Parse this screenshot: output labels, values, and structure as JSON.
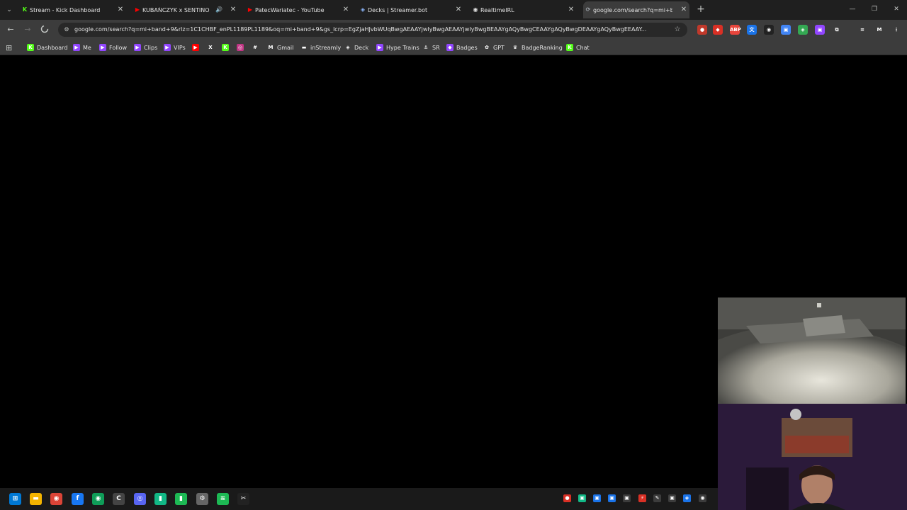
{
  "browser": {
    "tabs": [
      {
        "title": "Stream - Kick Dashboard",
        "favicon": "kick-icon",
        "color": "#53fc18"
      },
      {
        "title": "KUBAŃCZYK x SENTINO - R",
        "favicon": "youtube-icon",
        "color": "#ff0000",
        "audio": "speaker-icon"
      },
      {
        "title": "PatecWariatec - YouTube",
        "favicon": "youtube-icon",
        "color": "#ff0000"
      },
      {
        "title": "Decks | Streamer.bot",
        "favicon": "streamerbot-icon",
        "color": "#8ab4f8"
      },
      {
        "title": "RealtimeIRL",
        "favicon": "github-icon",
        "color": "#e3e3e3"
      },
      {
        "title": "google.com/search?q=mi+ban",
        "favicon": "loading-icon",
        "color": "#9aa0a6",
        "active": true
      }
    ],
    "tab_close_glyph": "✕",
    "new_tab_glyph": "+",
    "window_controls": {
      "minimize": "—",
      "restore": "❐",
      "close": "✕"
    },
    "tab_search_glyph": "⌄"
  },
  "toolbar": {
    "back": "←",
    "forward": "→",
    "reload": "✕",
    "info_glyph": "⚙",
    "url": "google.com/search?q=mi+band+9&rlz=1C1CHBF_enPL1189PL1189&oq=mi+band+9&gs_lcrp=EgZjaHJvbWUqBwgAEAAYjwIyBwgAEAAYjwIyBwgBEAAYgAQyBwgCEAAYgAQyBwgDEAAYgAQyBwgEEAAY...",
    "star_glyph": "☆",
    "extensions": [
      {
        "name": "record-extension-icon",
        "color": "#c0392b",
        "glyph": "●"
      },
      {
        "name": "shield-extension-icon",
        "color": "#d93025",
        "glyph": "◆"
      },
      {
        "name": "adblock-extension-icon",
        "color": "#e8453c",
        "glyph": "ABP"
      },
      {
        "name": "translate-extension-icon",
        "color": "#1a73e8",
        "glyph": "文"
      },
      {
        "name": "tampermonkey-extension-icon",
        "color": "#222222",
        "glyph": "◉"
      },
      {
        "name": "screenshot-extension-icon",
        "color": "#4285f4",
        "glyph": "▣"
      },
      {
        "name": "vpn-extension-icon",
        "color": "#34a853",
        "glyph": "◈"
      },
      {
        "name": "twitch-extension-icon",
        "color": "#9146ff",
        "glyph": "▣"
      },
      {
        "name": "puzzle-extensions-icon",
        "color": "#3c3c3c",
        "glyph": "⧉"
      },
      {
        "name": "media-control-icon",
        "color": "#3c3c3c",
        "glyph": "≡"
      },
      {
        "name": "profile-avatar-icon",
        "color": "#3c3c3c",
        "glyph": "M"
      },
      {
        "name": "menu-kebab-icon",
        "color": "#3c3c3c",
        "glyph": "⋮"
      }
    ]
  },
  "bookmarks": {
    "apps_glyph": "⊞",
    "items": [
      {
        "label": "Dashboard",
        "icon": "kick-icon",
        "color": "#53fc18",
        "glyph": "K"
      },
      {
        "label": "Me",
        "icon": "twitch-icon",
        "color": "#9146ff",
        "glyph": "▶"
      },
      {
        "label": "Follow",
        "icon": "twitch-icon",
        "color": "#9146ff",
        "glyph": "▶"
      },
      {
        "label": "Clips",
        "icon": "twitch-icon",
        "color": "#9146ff",
        "glyph": "▶"
      },
      {
        "label": "VIPs",
        "icon": "twitch-icon",
        "color": "#9146ff",
        "glyph": "▶"
      },
      {
        "label": "",
        "icon": "youtube-icon",
        "color": "#ff0000",
        "glyph": "▶"
      },
      {
        "label": "",
        "icon": "x-icon",
        "color": "#3c3c3c",
        "glyph": "X"
      },
      {
        "label": "",
        "icon": "kick-icon",
        "color": "#53fc18",
        "glyph": "K"
      },
      {
        "label": "",
        "icon": "instagram-icon",
        "color": "#c13584",
        "glyph": "◎"
      },
      {
        "label": "",
        "icon": "slack-icon",
        "color": "#3c3c3c",
        "glyph": "#"
      },
      {
        "label": "Gmail",
        "icon": "gmail-icon",
        "color": "#3c3c3c",
        "glyph": "M"
      },
      {
        "label": "inStreamly",
        "icon": "instreamly-icon",
        "color": "#3c3c3c",
        "glyph": "▬"
      },
      {
        "label": "Deck",
        "icon": "streamerbot-icon",
        "color": "#3c3c3c",
        "glyph": "◈"
      },
      {
        "label": "Hype Trains",
        "icon": "twitch-icon",
        "color": "#9146ff",
        "glyph": "▶"
      },
      {
        "label": "SR",
        "icon": "anchor-icon",
        "color": "#3c3c3c",
        "glyph": "⚓"
      },
      {
        "label": "Badges",
        "icon": "badge-icon",
        "color": "#9146ff",
        "glyph": "◆"
      },
      {
        "label": "GPT",
        "icon": "openai-icon",
        "color": "#3c3c3c",
        "glyph": "✿"
      },
      {
        "label": "BadgeRanking",
        "icon": "trophy-icon",
        "color": "#3c3c3c",
        "glyph": "♛"
      },
      {
        "label": "Chat",
        "icon": "kick-icon",
        "color": "#53fc18",
        "glyph": "K"
      }
    ]
  },
  "taskbar": {
    "apps": [
      {
        "name": "windows-start-icon",
        "color": "#0078d4",
        "glyph": "⊞"
      },
      {
        "name": "file-explorer-icon",
        "color": "#f4b400",
        "glyph": "▬"
      },
      {
        "name": "chrome-icon",
        "color": "#db4437",
        "glyph": "◉"
      },
      {
        "name": "facebook-icon",
        "color": "#1877f2",
        "glyph": "f"
      },
      {
        "name": "chrome-profile-icon",
        "color": "#0f9d58",
        "glyph": "◉"
      },
      {
        "name": "ccleaner-icon",
        "color": "#444444",
        "glyph": "C"
      },
      {
        "name": "discord-icon",
        "color": "#5865f2",
        "glyph": "◎"
      },
      {
        "name": "audio-mixer-icon",
        "color": "#12b886",
        "glyph": "▮"
      },
      {
        "name": "green-app-icon",
        "color": "#1db954",
        "glyph": "▮"
      },
      {
        "name": "settings-app-icon",
        "color": "#666666",
        "glyph": "⚙"
      },
      {
        "name": "spotify-icon",
        "color": "#1db954",
        "glyph": "≋"
      },
      {
        "name": "capcut-icon",
        "color": "#222222",
        "glyph": "✂"
      }
    ],
    "tray": [
      {
        "name": "record-tray-icon",
        "color": "#d93025",
        "glyph": "●"
      },
      {
        "name": "tray-app-icon-1",
        "color": "#12b886",
        "glyph": "▣"
      },
      {
        "name": "tray-app-icon-2",
        "color": "#1a73e8",
        "glyph": "▣"
      },
      {
        "name": "tray-app-icon-3",
        "color": "#1a73e8",
        "glyph": "▣"
      },
      {
        "name": "tray-app-icon-4",
        "color": "#3c3c3c",
        "glyph": "▣"
      },
      {
        "name": "tray-app-icon-5",
        "color": "#d93025",
        "glyph": "⚡"
      },
      {
        "name": "tray-app-icon-6",
        "color": "#3c3c3c",
        "glyph": "✎"
      },
      {
        "name": "tray-app-icon-7",
        "color": "#3c3c3c",
        "glyph": "▣"
      },
      {
        "name": "tray-app-icon-8",
        "color": "#1a73e8",
        "glyph": "◈"
      },
      {
        "name": "tray-app-icon-9",
        "color": "#3c3c3c",
        "glyph": "◉"
      }
    ]
  }
}
